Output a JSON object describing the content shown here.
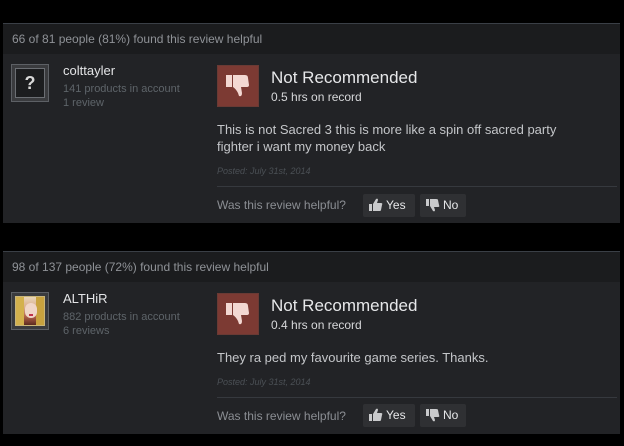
{
  "reviews": [
    {
      "helpful_summary": "66 of 81 people (81%) found this review helpful",
      "author": {
        "name": "colttayler",
        "products": "141 products in account",
        "review_count": "1 review",
        "avatar_icon": "question-mark-icon",
        "avatar_glyph": "?"
      },
      "verdict": "Not Recommended",
      "hours": "0.5 hrs on record",
      "text": "This is not Sacred 3 this is more like a spin off sacred party fighter i want my money back",
      "posted": "Posted: July 31st, 2014",
      "helpful_prompt": "Was this review helpful?",
      "yes_label": "Yes",
      "no_label": "No"
    },
    {
      "helpful_summary": "98 of 137 people (72%) found this review helpful",
      "author": {
        "name": "ALTHiR",
        "products": "882 products in account",
        "review_count": "6 reviews",
        "avatar_icon": "user-photo"
      },
      "verdict": "Not Recommended",
      "hours": "0.4 hrs on record",
      "text": "They ra ped my favourite game series. Thanks.",
      "posted": "Posted: July 31st, 2014",
      "helpful_prompt": "Was this review helpful?",
      "yes_label": "Yes",
      "no_label": "No"
    }
  ],
  "colors": {
    "thumb_down_bg": "#7c3a33",
    "panel_bg": "#222326",
    "header_bg": "#1b1c1e"
  }
}
